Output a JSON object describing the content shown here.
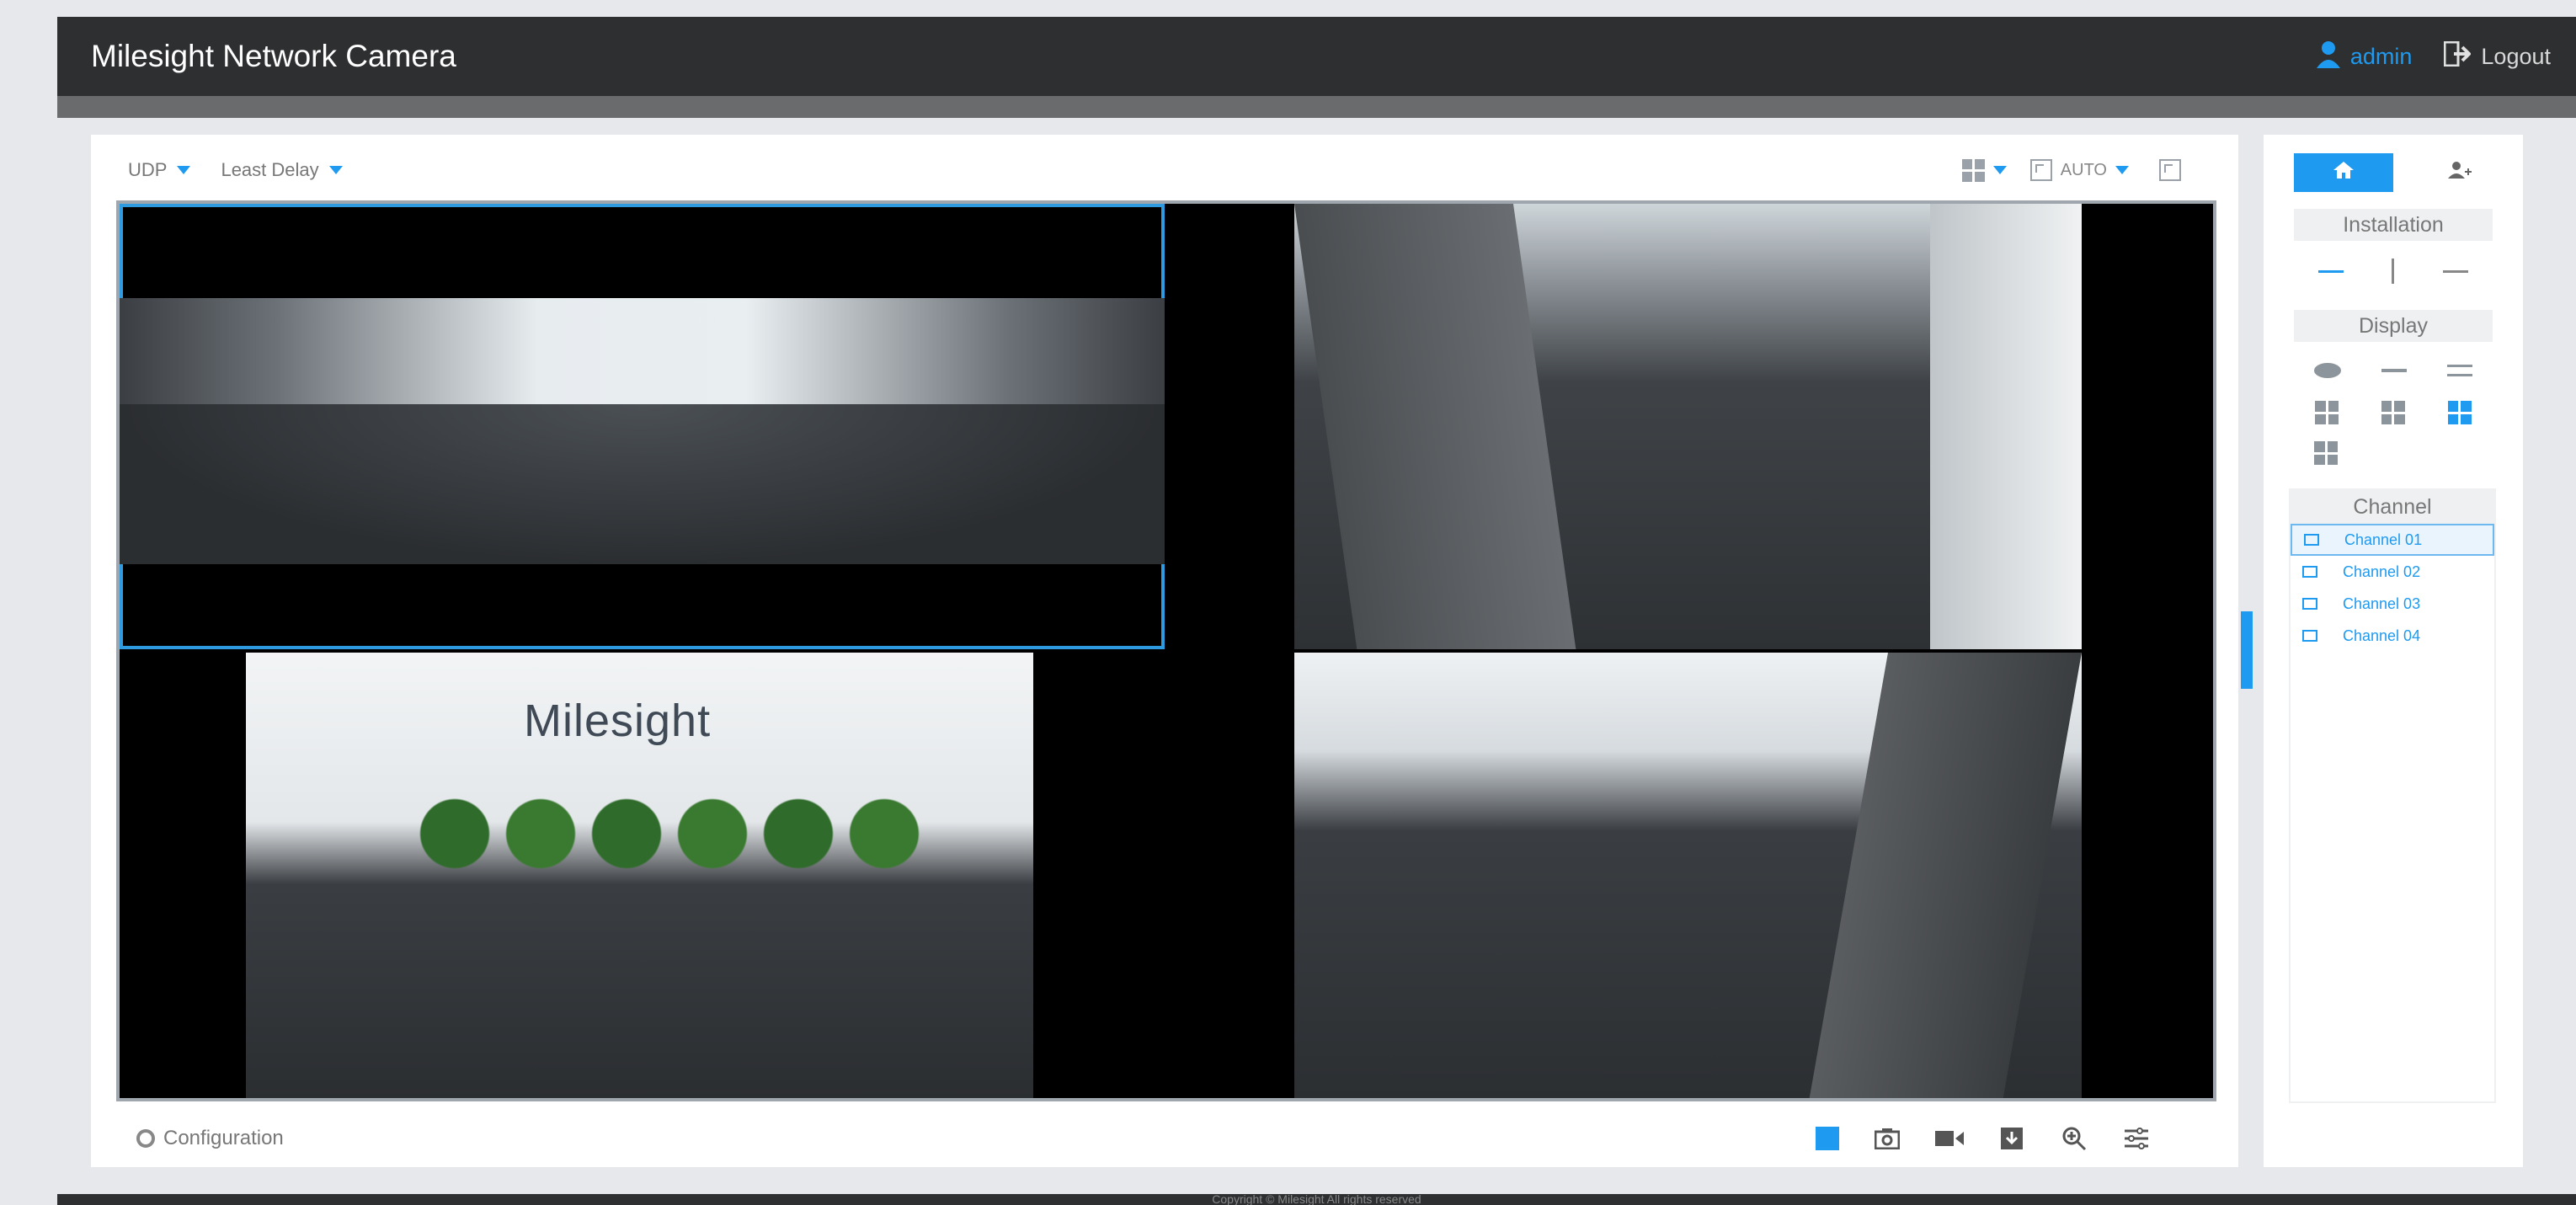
{
  "app": {
    "title": "Milesight Network Camera",
    "user": "admin",
    "logout": "Logout"
  },
  "toolbar": {
    "protocol": "UDP",
    "delay_mode": "Least Delay",
    "aspect_mode": "AUTO"
  },
  "video": {
    "tiles": [
      {
        "name": "Channel 01",
        "selected": true
      },
      {
        "name": "Channel 02",
        "selected": false
      },
      {
        "name": "Channel 03",
        "selected": false
      },
      {
        "name": "Channel 04",
        "selected": false
      }
    ],
    "brand_text": "Milesight"
  },
  "bottom": {
    "config_label": "Configuration",
    "controls": [
      "layout-icon",
      "snapshot-icon",
      "record-icon",
      "download-icon",
      "zoom-icon",
      "settings-icon"
    ]
  },
  "side": {
    "installation_label": "Installation",
    "display_label": "Display",
    "channel_label": "Channel",
    "channels": [
      "Channel 01",
      "Channel 02",
      "Channel 03",
      "Channel 04"
    ]
  },
  "footer": {
    "text": "Copyright © Milesight All rights reserved"
  },
  "colors": {
    "accent": "#1e9af0",
    "header_bg": "#2e2f31"
  }
}
